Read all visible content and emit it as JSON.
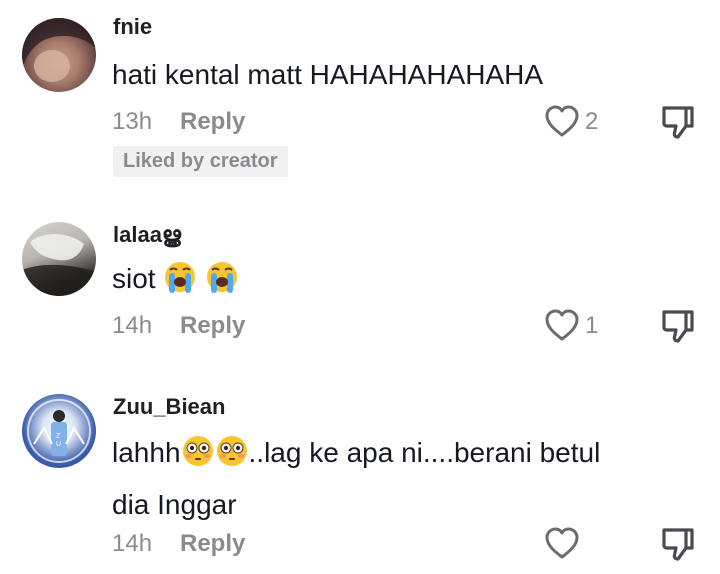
{
  "comments": [
    {
      "username": "fnie",
      "text": "hati kental matt HAHAHAHAHAHA",
      "time": "13h",
      "reply": "Reply",
      "likes": "2",
      "liked_by_creator": "Liked by creator"
    },
    {
      "username": "lalaa",
      "username_suffix": "ൠ",
      "text": "siot",
      "time": "14h",
      "reply": "Reply",
      "likes": "1"
    },
    {
      "username": "Zuu_Biean",
      "text_a": "lahhh",
      "text_b": "..lag ke apa ni....berani betul",
      "text_c": "dia Inggar",
      "time": "14h",
      "reply": "Reply",
      "likes": ""
    }
  ],
  "icons": {
    "like": "heart-outline-icon",
    "dislike": "thumbs-down-outline-icon",
    "crying": "loudly-crying-face-emoji",
    "flushed": "flushed-face-emoji"
  },
  "colors": {
    "muted": "#8a8b91",
    "text": "#161823",
    "badge_bg": "#f1f1f2"
  }
}
